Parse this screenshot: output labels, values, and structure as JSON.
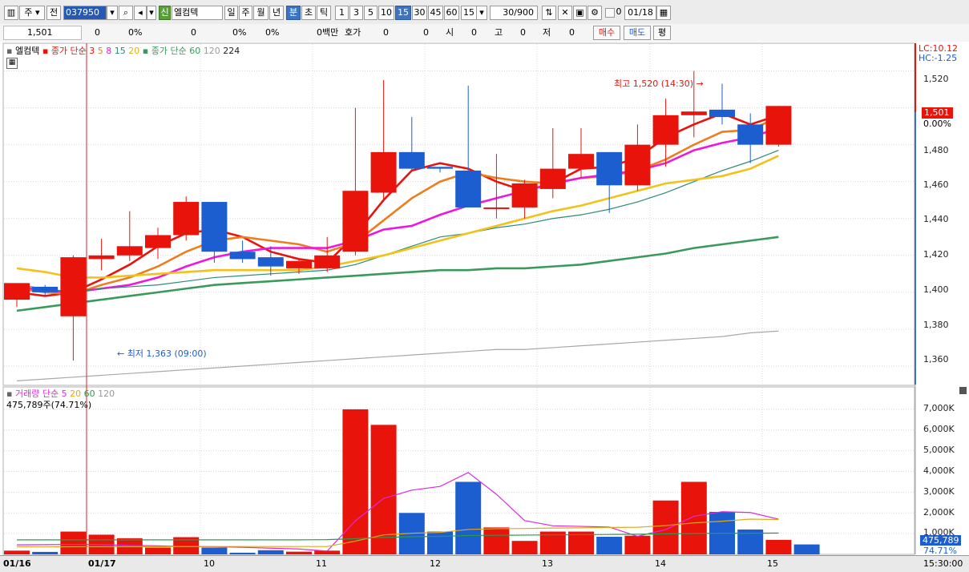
{
  "toolbar": {
    "type_label": "주",
    "prev_label": "전",
    "code": "037950",
    "credit_tag": "신",
    "name": "엘컴텍",
    "periods": [
      "일",
      "주",
      "월",
      "년",
      "분",
      "초",
      "틱"
    ],
    "minutes": [
      "1",
      "3",
      "5",
      "10",
      "15",
      "30",
      "45",
      "60"
    ],
    "interval_value": "15",
    "count_value": "30/900",
    "check_label": "0",
    "date_value": "01/18"
  },
  "infobar": {
    "price": "1,501",
    "change": "0",
    "change_pct": "0%",
    "v1": "0",
    "v1_pct": "0%",
    "v2_pct": "0%",
    "amount": "0백만",
    "quote_label": "호가",
    "q1": "0",
    "q2": "0",
    "open_label": "시",
    "open": "0",
    "high_label": "고",
    "high": "0",
    "low_label": "저",
    "low": "0",
    "buy": "매수",
    "sell": "매도",
    "avg": "평"
  },
  "price_legend": {
    "name": "엘컴텍",
    "ma_a": "종가 단순",
    "ma_a_periods": [
      "3",
      "5",
      "8",
      "15",
      "20"
    ],
    "ma_b": "종가 단순",
    "ma_b_periods": [
      "60",
      "120",
      "224"
    ]
  },
  "right_top": {
    "lc": "LC:10.12",
    "hc": "HC:-1.25"
  },
  "price_axis": [
    "1,520",
    "1,500",
    "1,480",
    "1,460",
    "1,440",
    "1,420",
    "1,400",
    "1,380",
    "1,360"
  ],
  "current_tag": {
    "price": "1,501",
    "pct": "0.00%"
  },
  "annotations": {
    "high": "최고 1,520 (14:30)",
    "low": "최저 1,363 (09:00)"
  },
  "volume_legend": {
    "name": "거래량",
    "ma": "단순",
    "periods": [
      "5",
      "20",
      "60",
      "120"
    ],
    "current": "475,789주(74.71%)"
  },
  "volume_axis": [
    "7,000K",
    "6,000K",
    "5,000K",
    "4,000K",
    "3,000K",
    "2,000K",
    "1,000K"
  ],
  "volume_tag": {
    "value": "475,789",
    "pct": "74.71%"
  },
  "x_axis": {
    "labels": [
      "01/16",
      "01/17",
      "10",
      "11",
      "12",
      "13",
      "14",
      "15"
    ],
    "time": "15:30:00"
  },
  "colors": {
    "up": "#e8140c",
    "down": "#1c5ed0"
  },
  "chart_data": {
    "type": "candlestick",
    "price_range": [
      1350,
      1535
    ],
    "candles": [
      {
        "o": 1396,
        "h": 1403,
        "l": 1392,
        "c": 1405
      },
      {
        "o": 1403,
        "h": 1404,
        "l": 1398,
        "c": 1400
      },
      {
        "o": 1387,
        "h": 1420,
        "l": 1363,
        "c": 1419
      },
      {
        "o": 1418,
        "h": 1429,
        "l": 1412,
        "c": 1420
      },
      {
        "o": 1420,
        "h": 1444,
        "l": 1417,
        "c": 1425
      },
      {
        "o": 1424,
        "h": 1435,
        "l": 1418,
        "c": 1431
      },
      {
        "o": 1431,
        "h": 1452,
        "l": 1428,
        "c": 1449
      },
      {
        "o": 1449,
        "h": 1449,
        "l": 1416,
        "c": 1422
      },
      {
        "o": 1422,
        "h": 1428,
        "l": 1416,
        "c": 1418
      },
      {
        "o": 1419,
        "h": 1425,
        "l": 1409,
        "c": 1414
      },
      {
        "o": 1413,
        "h": 1418,
        "l": 1410,
        "c": 1417
      },
      {
        "o": 1413,
        "h": 1430,
        "l": 1411,
        "c": 1420
      },
      {
        "o": 1422,
        "h": 1500,
        "l": 1420,
        "c": 1455
      },
      {
        "o": 1454,
        "h": 1515,
        "l": 1449,
        "c": 1476
      },
      {
        "o": 1476,
        "h": 1495,
        "l": 1466,
        "c": 1467
      },
      {
        "o": 1468,
        "h": 1468,
        "l": 1465,
        "c": 1467
      },
      {
        "o": 1466,
        "h": 1512,
        "l": 1459,
        "c": 1446
      },
      {
        "o": 1446,
        "h": 1475,
        "l": 1440,
        "c": 1446
      },
      {
        "o": 1446,
        "h": 1461,
        "l": 1440,
        "c": 1459
      },
      {
        "o": 1456,
        "h": 1489,
        "l": 1451,
        "c": 1467
      },
      {
        "o": 1467,
        "h": 1489,
        "l": 1462,
        "c": 1475
      },
      {
        "o": 1476,
        "h": 1476,
        "l": 1443,
        "c": 1458
      },
      {
        "o": 1458,
        "h": 1491,
        "l": 1455,
        "c": 1480
      },
      {
        "o": 1480,
        "h": 1505,
        "l": 1468,
        "c": 1496
      },
      {
        "o": 1496,
        "h": 1520,
        "l": 1484,
        "c": 1498
      },
      {
        "o": 1499,
        "h": 1513,
        "l": 1491,
        "c": 1495
      },
      {
        "o": 1491,
        "h": 1497,
        "l": 1470,
        "c": 1480
      },
      {
        "o": 1480,
        "h": 1501,
        "l": 1479,
        "c": 1501
      }
    ],
    "ma_lines": [
      {
        "period": "3",
        "color": "#e8140c",
        "values": [
          1400,
          1398,
          1400,
          1407,
          1415,
          1425,
          1432,
          1434,
          1430,
          1422,
          1418,
          1416,
          1431,
          1450,
          1466,
          1470,
          1467,
          1460,
          1455,
          1459,
          1467,
          1468,
          1473,
          1484,
          1491,
          1497,
          1491,
          1496
        ]
      },
      {
        "period": "5",
        "color": "#ee7d1e",
        "values": [
          1402,
          1400,
          1399,
          1404,
          1408,
          1414,
          1422,
          1428,
          1430,
          1428,
          1426,
          1422,
          1427,
          1439,
          1451,
          1460,
          1465,
          1462,
          1460,
          1459,
          1462,
          1463,
          1466,
          1472,
          1480,
          1487,
          1488,
          1495
        ]
      },
      {
        "period": "8",
        "color": "#ee18dd",
        "values": [
          1403,
          1401,
          1400,
          1402,
          1404,
          1408,
          1414,
          1419,
          1422,
          1424,
          1424,
          1424,
          1428,
          1434,
          1436,
          1442,
          1447,
          1451,
          1455,
          1459,
          1462,
          1464,
          1466,
          1470,
          1477,
          1481,
          1484,
          1489
        ]
      },
      {
        "period": "15",
        "color": "#2c8a7a",
        "values": [
          1404,
          1402,
          1400,
          1402,
          1403,
          1404,
          1406,
          1408,
          1409,
          1410,
          1411,
          1412,
          1415,
          1420,
          1425,
          1430,
          1432,
          1435,
          1437,
          1440,
          1442,
          1445,
          1449,
          1454,
          1460,
          1466,
          1471,
          1477
        ]
      },
      {
        "period": "20",
        "color": "#f3c21a",
        "values": [
          1413,
          1411,
          1408,
          1408,
          1409,
          1410,
          1411,
          1412,
          1412,
          1412,
          1412,
          1414,
          1417,
          1420,
          1424,
          1428,
          1432,
          1436,
          1440,
          1444,
          1447,
          1451,
          1455,
          1459,
          1461,
          1463,
          1467,
          1474
        ]
      },
      {
        "period": "60",
        "color": "#3a9a5c",
        "values": [
          1390,
          1392,
          1394,
          1396,
          1398,
          1400,
          1402,
          1404,
          1405,
          1406,
          1407,
          1408,
          1409,
          1410,
          1411,
          1412,
          1412,
          1413,
          1413,
          1414,
          1415,
          1417,
          1419,
          1421,
          1424,
          1426,
          1428,
          1430
        ]
      },
      {
        "period": "120",
        "color": "#a8a8a8",
        "values": [
          1352,
          1353,
          1354,
          1355,
          1356,
          1357,
          1358,
          1359,
          1360,
          1361,
          1362,
          1363,
          1364,
          1365,
          1366,
          1367,
          1368,
          1369,
          1369,
          1370,
          1371,
          1372,
          1373,
          1374,
          1375,
          1376,
          1378,
          1379
        ]
      }
    ],
    "volume_range": [
      0,
      7500
    ],
    "volumes": [
      180,
      120,
      1100,
      950,
      780,
      330,
      830,
      330,
      80,
      200,
      130,
      180,
      7000,
      6250,
      2000,
      1100,
      3500,
      1300,
      650,
      1100,
      1100,
      850,
      900,
      2600,
      3500,
      2050,
      1200,
      700,
      480
    ],
    "volume_ma": [
      {
        "period": "5",
        "color": "#dc2adc",
        "values": [
          460,
          470,
          480,
          470,
          430,
          410,
          380,
          370,
          340,
          300,
          260,
          160,
          1620,
          2700,
          3100,
          3280,
          3950,
          2900,
          1630,
          1380,
          1350,
          1320,
          870,
          1200,
          1840,
          2060,
          2020,
          1700
        ]
      },
      {
        "period": "20",
        "color": "#e6a817",
        "values": [
          360,
          360,
          370,
          370,
          370,
          370,
          380,
          380,
          380,
          380,
          380,
          380,
          640,
          940,
          1020,
          1060,
          1200,
          1240,
          1250,
          1270,
          1280,
          1300,
          1310,
          1390,
          1520,
          1600,
          1700,
          1680
        ]
      },
      {
        "period": "60",
        "color": "#2c9a4c",
        "values": [
          700,
          700,
          700,
          700,
          700,
          700,
          700,
          700,
          700,
          700,
          700,
          710,
          760,
          820,
          850,
          870,
          910,
          920,
          930,
          940,
          950,
          960,
          970,
          990,
          1010,
          1020,
          1020,
          1030
        ]
      }
    ]
  }
}
